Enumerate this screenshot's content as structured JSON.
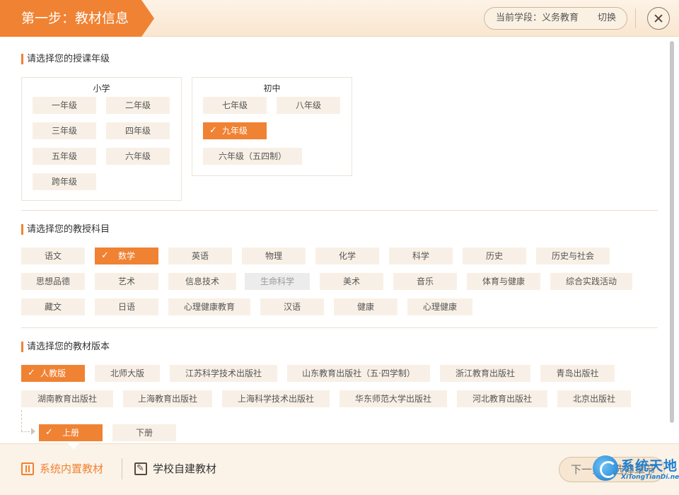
{
  "header": {
    "step_title": "第一步：教材信息",
    "stage_label": "当前学段：义务教育",
    "switch_label": "切换"
  },
  "grade_section": {
    "title": "请选择您的授课年级",
    "primary_title": "小学",
    "primary": [
      "一年级",
      "二年级",
      "三年级",
      "四年级",
      "五年级",
      "六年级",
      "跨年级"
    ],
    "junior_title": "初中",
    "junior": [
      "七年级",
      "八年级",
      "九年级",
      "六年级（五四制）"
    ],
    "selected": "九年级"
  },
  "subject_section": {
    "title": "请选择您的教授科目",
    "subjects": [
      "语文",
      "数学",
      "英语",
      "物理",
      "化学",
      "科学",
      "历史",
      "历史与社会",
      "思想品德",
      "艺术",
      "信息技术",
      "生命科学",
      "美术",
      "音乐",
      "体育与健康",
      "综合实践活动",
      "藏文",
      "日语",
      "心理健康教育",
      "汉语",
      "健康",
      "心理健康"
    ],
    "selected": "数学",
    "disabled": "生命科学"
  },
  "edition_section": {
    "title": "请选择您的教材版本",
    "editions": [
      "人教版",
      "北师大版",
      "江苏科学技术出版社",
      "山东教育出版社（五·四学制）",
      "浙江教育出版社",
      "青岛出版社",
      "湖南教育出版社",
      "上海教育出版社",
      "上海科学技术出版社",
      "华东师范大学出版社",
      "河北教育出版社",
      "北京出版社"
    ],
    "selected": "人教版",
    "volumes": [
      "上册",
      "下册"
    ],
    "selected_volume": "上册"
  },
  "footer": {
    "tab_builtin": "系统内置教材",
    "tab_school": "学校自建教材",
    "next_label": "下一步：选择章节"
  },
  "watermark": {
    "main": "系统天地",
    "sub": "XiTongTianDi.net"
  }
}
